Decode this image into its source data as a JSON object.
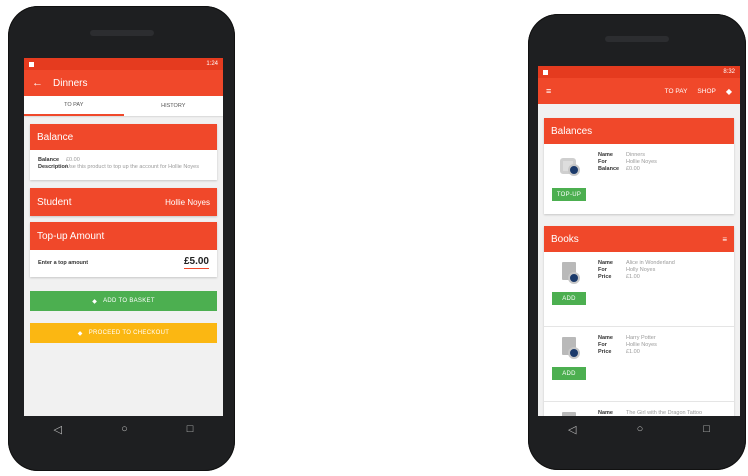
{
  "left_phone": {
    "status_time": "1:24",
    "app_title": "Dinners",
    "tabs": [
      {
        "label": "TO PAY",
        "active": true
      },
      {
        "label": "HISTORY",
        "active": false
      }
    ],
    "balance_card": {
      "title": "Balance",
      "rows": [
        {
          "key": "Balance",
          "value": "£0.00"
        },
        {
          "key": "Description",
          "value": "Use this product to top up the account for Hollie Noyes"
        }
      ]
    },
    "student_card": {
      "title": "Student",
      "value": "Hollie Noyes"
    },
    "topup_card": {
      "title": "Top-up Amount",
      "prompt": "Enter a top amount",
      "amount": "£5.00"
    },
    "add_to_basket_label": "ADD TO BASKET",
    "checkout_label": "PROCEED TO CHECKOUT"
  },
  "right_phone": {
    "status_time": "8:32",
    "appbar_actions": [
      {
        "label": "TO PAY"
      },
      {
        "label": "SHOP"
      }
    ],
    "balances_section": {
      "title": "Balances",
      "item": {
        "rows": [
          {
            "key": "Name",
            "value": "Dinners"
          },
          {
            "key": "For",
            "value": "Hollie Noyes"
          },
          {
            "key": "Balance",
            "value": "£0.00"
          }
        ],
        "button_label": "TOP-UP"
      }
    },
    "books_section": {
      "title": "Books",
      "items": [
        {
          "rows": [
            {
              "key": "Name",
              "value": "Alice in Wonderland"
            },
            {
              "key": "For",
              "value": "Holly Noyes"
            },
            {
              "key": "Price",
              "value": "£1.00"
            }
          ],
          "button_label": "ADD"
        },
        {
          "rows": [
            {
              "key": "Name",
              "value": "Harry Potter"
            },
            {
              "key": "For",
              "value": "Hollie Noyes"
            },
            {
              "key": "Price",
              "value": "£1.00"
            }
          ],
          "button_label": "ADD"
        },
        {
          "rows": [
            {
              "key": "Name",
              "value": "The Girl with the Dragon Tattoo"
            }
          ]
        }
      ]
    }
  },
  "colors": {
    "primary": "#f0482a",
    "status": "#e53b1f",
    "green": "#4caf50",
    "yellow": "#fbb712",
    "device": "#1e1f21"
  }
}
